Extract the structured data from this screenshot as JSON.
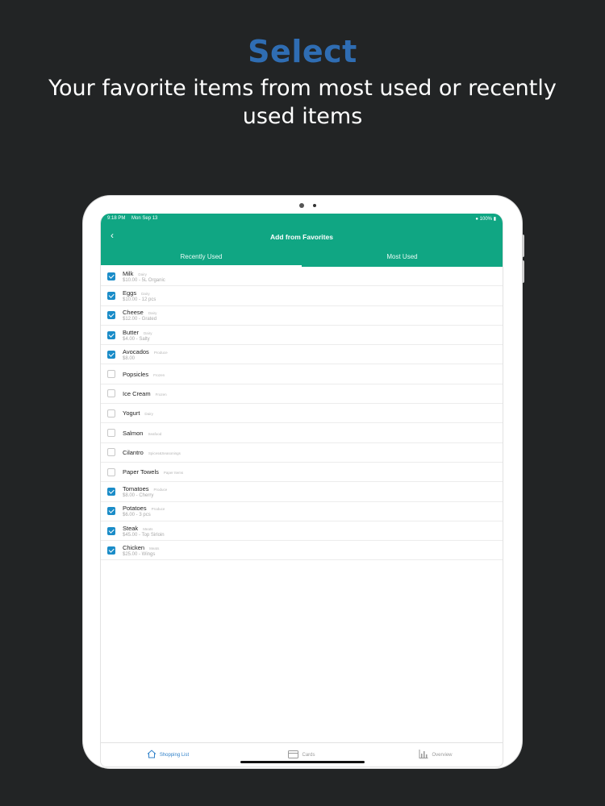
{
  "headline": {
    "title": "Select",
    "subtitle": "Your favorite items from most used or recently used items"
  },
  "status_bar": {
    "time": "9:18 PM",
    "date": "Mon Sep 13",
    "battery": "100%"
  },
  "nav": {
    "title": "Add from Favorites",
    "back_icon": "chevron-left-icon"
  },
  "tabs": [
    {
      "label": "Recently Used",
      "active": true
    },
    {
      "label": "Most Used",
      "active": false
    }
  ],
  "items": [
    {
      "name": "Milk",
      "category": "Dairy",
      "detail": "$10.00 - 5L Organic",
      "checked": true
    },
    {
      "name": "Eggs",
      "category": "Dairy",
      "detail": "$10.00 - 12 pcs",
      "checked": true
    },
    {
      "name": "Cheese",
      "category": "Dairy",
      "detail": "$12.00 - Grated",
      "checked": true
    },
    {
      "name": "Butter",
      "category": "Dairy",
      "detail": "$4.00 - Salty",
      "checked": true
    },
    {
      "name": "Avocados",
      "category": "Produce",
      "detail": "$8.00",
      "checked": true
    },
    {
      "name": "Popsicles",
      "category": "Frozen",
      "detail": "",
      "checked": false
    },
    {
      "name": "Ice Cream",
      "category": "Frozen",
      "detail": "",
      "checked": false
    },
    {
      "name": "Yogurt",
      "category": "Dairy",
      "detail": "",
      "checked": false
    },
    {
      "name": "Salmon",
      "category": "Seafood",
      "detail": "",
      "checked": false
    },
    {
      "name": "Cilantro",
      "category": "Spices&Seasonings",
      "detail": "",
      "checked": false
    },
    {
      "name": "Paper Towels",
      "category": "Paper Items",
      "detail": "",
      "checked": false
    },
    {
      "name": "Tomatoes",
      "category": "Produce",
      "detail": "$8.00 - Cherry",
      "checked": true
    },
    {
      "name": "Potatoes",
      "category": "Produce",
      "detail": "$6.00 - 3 pcs",
      "checked": true
    },
    {
      "name": "Steak",
      "category": "Meats",
      "detail": "$45.00 - Top Sirloin",
      "checked": true
    },
    {
      "name": "Chicken",
      "category": "Meats",
      "detail": "$25.00 - Wings",
      "checked": true
    }
  ],
  "bottom_tabs": [
    {
      "label": "Shopping List",
      "icon": "home-icon",
      "active": true
    },
    {
      "label": "Cards",
      "icon": "card-icon",
      "active": false
    },
    {
      "label": "Overview",
      "icon": "bar-chart-icon",
      "active": false
    }
  ],
  "colors": {
    "background": "#222425",
    "title": "#2f6db3",
    "appbar": "#10a683",
    "checkbox": "#1a8cc8",
    "active_tab": "#2f80c9"
  }
}
